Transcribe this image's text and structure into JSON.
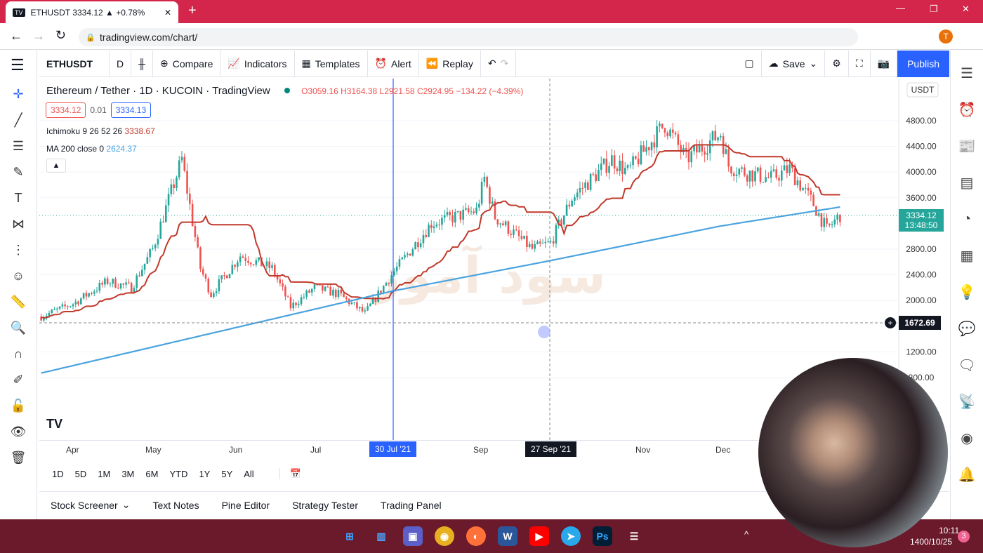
{
  "browser": {
    "tab_title": "ETHUSDT 3334.12 ▲ +0.78%",
    "url": "tradingview.com/chart/",
    "profile_initial": "T"
  },
  "toolbar": {
    "symbol": "ETHUSDT",
    "interval": "D",
    "compare": "Compare",
    "indicators": "Indicators",
    "templates": "Templates",
    "alert": "Alert",
    "replay": "Replay",
    "save": "Save",
    "publish": "Publish"
  },
  "legend": {
    "title": "Ethereum / Tether · 1D · KUCOIN · TradingView",
    "open": "O3059.16",
    "high": "H3164.38",
    "low": "L2921.58",
    "close": "C2924.95",
    "change": "−134.22 (−4.39%)",
    "bid": "3334.12",
    "spread": "0.01",
    "ask": "3334.13",
    "ichimoku": "Ichimoku 9 26 52 26",
    "ichimoku_value": "3338.67",
    "ma": "MA 200 close 0",
    "ma_value": "2624.37"
  },
  "price_axis": {
    "currency": "USDT",
    "ticks": [
      "4800.00",
      "4400.00",
      "4000.00",
      "3600.00",
      "2800.00",
      "2400.00",
      "2000.00",
      "1200.00",
      "800.00"
    ],
    "last_price": "3334.12",
    "countdown": "13:48:50",
    "crosshair_price": "1672.69"
  },
  "time_axis": {
    "ticks": [
      "Apr",
      "May",
      "Jun",
      "Jul",
      "Sep",
      "Nov",
      "Dec"
    ],
    "highlight_1": "30 Jul '21",
    "highlight_2": "27 Sep '21"
  },
  "ranges": [
    "1D",
    "5D",
    "1M",
    "3M",
    "6M",
    "YTD",
    "1Y",
    "5Y",
    "All"
  ],
  "bottom_tabs": [
    "Stock Screener",
    "Text Notes",
    "Pine Editor",
    "Strategy Tester",
    "Trading Panel"
  ],
  "watermark": "سود آموز",
  "taskbar": {
    "time": "10:11",
    "date": "1400/10/25",
    "notifications": "3"
  },
  "colors": {
    "up": "#26a69a",
    "down": "#ef5350",
    "kijun": "#c0392b",
    "ma": "#4aa3df",
    "accent": "#2962ff",
    "tabbar": "#d4264b",
    "taskbar": "#6b1a2b"
  },
  "chart_data": {
    "type": "candlestick",
    "symbol": "ETHUSDT",
    "interval": "1D",
    "ylim": [
      800,
      5000
    ],
    "price_path": [
      [
        "2021-03-20",
        1750
      ],
      [
        "2021-04-01",
        1950
      ],
      [
        "2021-04-14",
        2300
      ],
      [
        "2021-04-23",
        2200
      ],
      [
        "2021-05-01",
        2800
      ],
      [
        "2021-05-12",
        4200
      ],
      [
        "2021-05-19",
        2500
      ],
      [
        "2021-05-23",
        2100
      ],
      [
        "2021-06-03",
        2700
      ],
      [
        "2021-06-15",
        2500
      ],
      [
        "2021-06-22",
        1900
      ],
      [
        "2021-07-01",
        2200
      ],
      [
        "2021-07-10",
        2100
      ],
      [
        "2021-07-20",
        1800
      ],
      [
        "2021-07-30",
        2400
      ],
      [
        "2021-08-14",
        3200
      ],
      [
        "2021-08-31",
        3400
      ],
      [
        "2021-09-03",
        3900
      ],
      [
        "2021-09-07",
        3300
      ],
      [
        "2021-09-21",
        2800
      ],
      [
        "2021-09-28",
        2900
      ],
      [
        "2021-10-06",
        3600
      ],
      [
        "2021-10-21",
        4200
      ],
      [
        "2021-10-27",
        4000
      ],
      [
        "2021-11-10",
        4750
      ],
      [
        "2021-11-18",
        4200
      ],
      [
        "2021-12-01",
        4600
      ],
      [
        "2021-12-04",
        4100
      ],
      [
        "2021-12-10",
        4000
      ],
      [
        "2021-12-20",
        3900
      ],
      [
        "2021-12-27",
        4050
      ],
      [
        "2022-01-05",
        3500
      ],
      [
        "2022-01-10",
        3100
      ],
      [
        "2022-01-15",
        3334
      ]
    ],
    "ma200": [
      [
        "2021-03-20",
        870
      ],
      [
        "2021-07-30",
        2144
      ],
      [
        "2021-09-27",
        2614
      ],
      [
        "2021-12-01",
        3160
      ],
      [
        "2022-01-15",
        3456
      ]
    ]
  }
}
